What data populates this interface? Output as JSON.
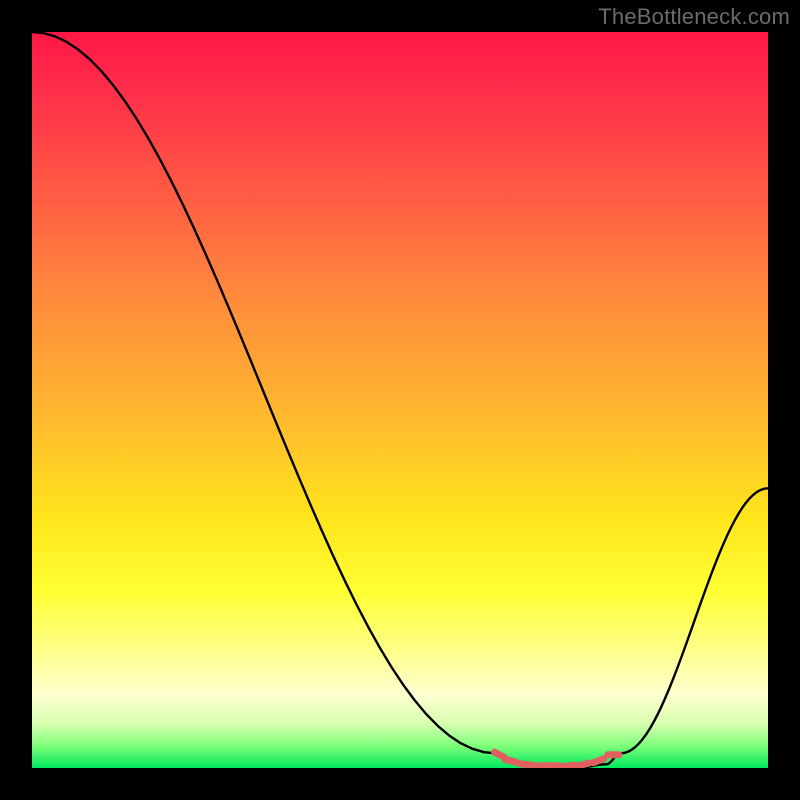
{
  "watermark": "TheBottleneck.com",
  "chart_data": {
    "type": "line",
    "title": "",
    "xlabel": "",
    "ylabel": "",
    "xlim": [
      0,
      100
    ],
    "ylim": [
      0,
      100
    ],
    "series": [
      {
        "name": "bottleneck-curve",
        "x": [
          0,
          63,
          66,
          70,
          74,
          78,
          80,
          100
        ],
        "y": [
          100,
          2,
          0.5,
          0,
          0,
          0.5,
          2,
          38
        ]
      }
    ],
    "marker_series": {
      "name": "optimal-range-markers",
      "x": [
        63.5,
        65,
        67,
        69,
        71,
        73,
        75,
        77,
        79
      ],
      "y": [
        1.8,
        1.0,
        0.5,
        0.3,
        0.3,
        0.3,
        0.5,
        1.0,
        1.8
      ]
    },
    "gradient_stops": [
      {
        "pos": 0,
        "color": "#ff1746"
      },
      {
        "pos": 8,
        "color": "#ff2e4a"
      },
      {
        "pos": 22,
        "color": "#ff5b44"
      },
      {
        "pos": 36,
        "color": "#ff8a3c"
      },
      {
        "pos": 52,
        "color": "#ffb82f"
      },
      {
        "pos": 66,
        "color": "#ffe51c"
      },
      {
        "pos": 76,
        "color": "#ffff33"
      },
      {
        "pos": 84,
        "color": "#ffff8a"
      },
      {
        "pos": 90,
        "color": "#ffffd0"
      },
      {
        "pos": 94,
        "color": "#d7ffb0"
      },
      {
        "pos": 97,
        "color": "#7fff7a"
      },
      {
        "pos": 100,
        "color": "#00e85f"
      }
    ],
    "colors": {
      "curve": "#000000",
      "marker": "#e06060",
      "background_frame": "#000000"
    }
  }
}
